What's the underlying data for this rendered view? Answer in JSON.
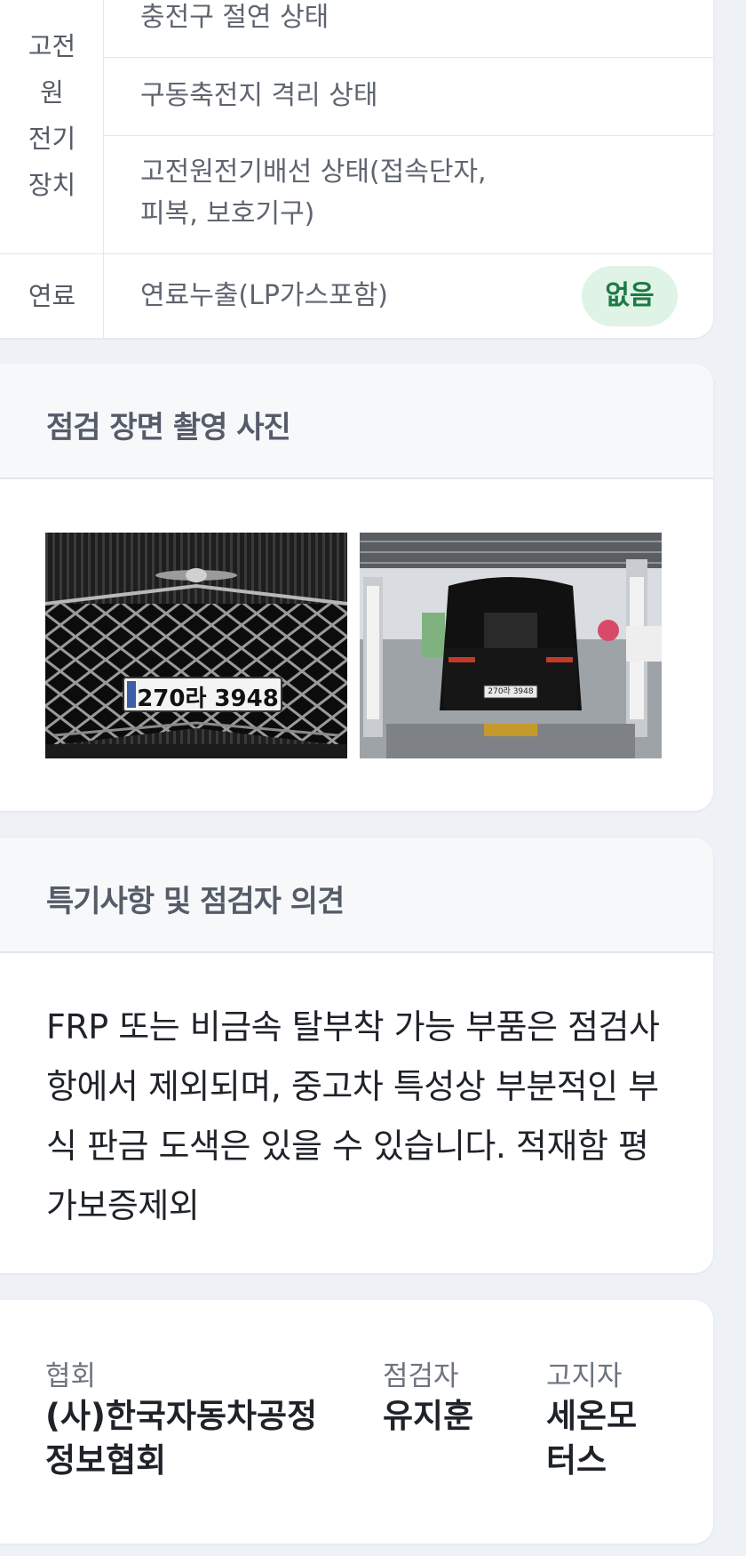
{
  "table": {
    "category_power": "고전원전기장치",
    "category_power_lines": [
      "고전",
      "원",
      "전기",
      "장치"
    ],
    "category_fuel": "연료",
    "items": [
      "충전구 절연 상태",
      "구동축전지 격리 상태",
      "고전원전기배선 상태(접속단자,",
      "피복, 보호기구)",
      "연료누출(LP가스포함)"
    ],
    "fuel_status": "없음",
    "colors": {
      "badge_bg": "#dff3e6",
      "badge_text": "#1d7a45"
    }
  },
  "photos": {
    "title": "점검 장면 촬영 사진",
    "front_plate": "270라 3948",
    "rear_plate": "270라 3948"
  },
  "notes": {
    "title": "특기사항 및 점검자 의견",
    "text": "FRP 또는 비금속 탈부착 가능 부품은 점검사항에서 제외되며, 중고차 특성상 부분적인 부식 판금 도색은 있을 수 있습니다. 적재함 평가보증제외"
  },
  "footer": {
    "association_label": "협회",
    "association_value": "(사)한국자동차공정정보협회",
    "inspector_label": "점검자",
    "inspector_value": "유지훈",
    "notifier_label": "고지자",
    "notifier_value": "세온모터스"
  }
}
